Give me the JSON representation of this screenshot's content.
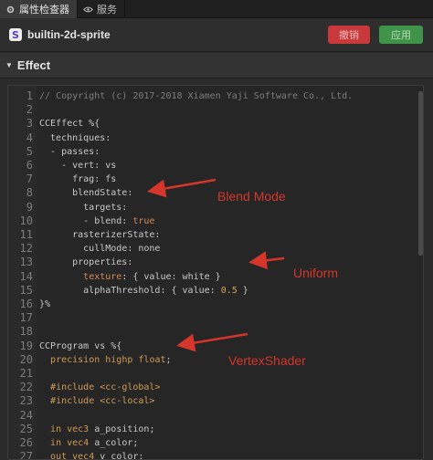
{
  "tabs": [
    {
      "label": "属性检查器",
      "icon": "gear-icon"
    },
    {
      "label": "服务",
      "icon": "eye-icon"
    }
  ],
  "header": {
    "asset_icon": "S",
    "asset_name": "builtin-2d-sprite",
    "revert_label": "撤销",
    "apply_label": "应用"
  },
  "section": {
    "title": "Effect"
  },
  "colors": {
    "revert": "#c9393b",
    "apply": "#40944a",
    "annotation": "#d4362c"
  },
  "code_lines": [
    {
      "n": "1",
      "text": "// Copyright (c) 2017-2018 Xiamen Yaji Software Co., Ltd."
    },
    {
      "n": "2",
      "text": ""
    },
    {
      "n": "3",
      "text": "CCEffect %{"
    },
    {
      "n": "4",
      "text": "  techniques:"
    },
    {
      "n": "5",
      "text": "  - passes:"
    },
    {
      "n": "6",
      "text": "    - vert: vs"
    },
    {
      "n": "7",
      "text": "      frag: fs"
    },
    {
      "n": "8",
      "text": "      blendState:"
    },
    {
      "n": "9",
      "text": "        targets:"
    },
    {
      "n": "10",
      "text": "        - blend: true"
    },
    {
      "n": "11",
      "text": "      rasterizerState:"
    },
    {
      "n": "12",
      "text": "        cullMode: none"
    },
    {
      "n": "13",
      "text": "      properties:"
    },
    {
      "n": "14",
      "text": "        texture: { value: white }"
    },
    {
      "n": "15",
      "text": "        alphaThreshold: { value: 0.5 }"
    },
    {
      "n": "16",
      "text": "}%"
    },
    {
      "n": "17",
      "text": ""
    },
    {
      "n": "18",
      "text": ""
    },
    {
      "n": "19",
      "text": "CCProgram vs %{"
    },
    {
      "n": "20",
      "text": "  precision highp float;"
    },
    {
      "n": "21",
      "text": ""
    },
    {
      "n": "22",
      "text": "  #include <cc-global>"
    },
    {
      "n": "23",
      "text": "  #include <cc-local>"
    },
    {
      "n": "24",
      "text": ""
    },
    {
      "n": "25",
      "text": "  in vec3 a_position;"
    },
    {
      "n": "26",
      "text": "  in vec4 a_color;"
    },
    {
      "n": "27",
      "text": "  out vec4 v_color;"
    }
  ],
  "annotations": [
    {
      "text": "Blend Mode"
    },
    {
      "text": "Uniform"
    },
    {
      "text": "VertexShader"
    }
  ]
}
